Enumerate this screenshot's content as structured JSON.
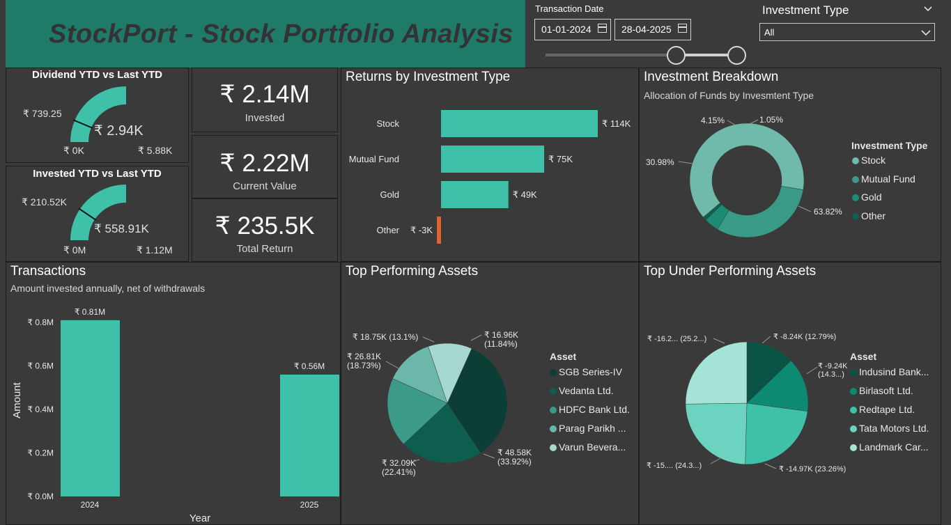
{
  "banner": {
    "title": "StockPort - Stock Portfolio Analysis"
  },
  "filters": {
    "transaction_date_label": "Transaction Date",
    "start_date": "01-01-2024",
    "end_date": "28-04-2025",
    "investment_type_label": "Investment Type",
    "investment_type_value": "All"
  },
  "gauges": [
    {
      "title": "Dividend YTD vs Last YTD",
      "target": "₹ 739.25",
      "value": "₹ 2.94K",
      "min": "₹ 0K",
      "max": "₹ 5.88K",
      "fill_fraction": 0.5,
      "target_fraction": 0.126
    },
    {
      "title": "Invested YTD vs Last YTD",
      "target": "₹ 210.52K",
      "value": "₹ 558.91K",
      "min": "₹ 0M",
      "max": "₹ 1.12M",
      "fill_fraction": 0.5,
      "target_fraction": 0.188
    }
  ],
  "kpis": [
    {
      "value": "₹ 2.14M",
      "label": "Invested"
    },
    {
      "value": "₹ 2.22M",
      "label": "Current Value"
    },
    {
      "value": "₹ 235.5K",
      "label": "Total Return"
    }
  ],
  "colors": {
    "teal": "#3ec1a8",
    "negative": "#e0622f",
    "donut": [
      "#6fbaab",
      "#3a9a88",
      "#1b8c73",
      "#11604f"
    ],
    "top_pie": [
      "#0b3f35",
      "#0e5e50",
      "#3b9a88",
      "#6bb8aa",
      "#a6d8cf"
    ],
    "under_pie": [
      "#0a5446",
      "#0d8a72",
      "#3ec1a8",
      "#6bd3bf",
      "#a5e3d7"
    ]
  },
  "returns": {
    "title": "Returns by Investment Type",
    "chart_data": {
      "type": "bar",
      "orientation": "horizontal",
      "categories": [
        "Stock",
        "Mutual Fund",
        "Gold",
        "Other"
      ],
      "values": [
        114,
        75,
        49,
        -3
      ],
      "labels": [
        "₹ 114K",
        "₹ 75K",
        "₹ 49K",
        "₹ -3K"
      ]
    }
  },
  "breakdown": {
    "title": "Investment Breakdown",
    "subtitle": "Allocation of Funds by Invesmtent Type",
    "legend_title": "Investment Type",
    "chart_data": {
      "type": "pie",
      "donut": true,
      "categories": [
        "Stock",
        "Mutual Fund",
        "Gold",
        "Other"
      ],
      "values": [
        63.82,
        30.98,
        4.15,
        1.05
      ],
      "labels": [
        "63.82%",
        "30.98%",
        "4.15%",
        "1.05%"
      ]
    }
  },
  "transactions": {
    "title": "Transactions",
    "subtitle": "Amount invested annually, net of withdrawals",
    "chart_data": {
      "type": "bar",
      "categories": [
        "2024",
        "2025"
      ],
      "values": [
        0.81,
        0.56
      ],
      "labels": [
        "₹ 0.81M",
        "₹ 0.56M"
      ],
      "xlabel": "Year",
      "ylabel": "Amount",
      "ylim": [
        0,
        0.8
      ],
      "yticks": [
        "₹ 0.0M",
        "₹ 0.2M",
        "₹ 0.4M",
        "₹ 0.6M",
        "₹ 0.8M"
      ],
      "grid": false
    }
  },
  "top_assets": {
    "title": "Top Performing Assets",
    "legend_title": "Asset",
    "chart_data": {
      "type": "pie",
      "categories": [
        "SGB Series-IV",
        "Vedanta Ltd.",
        "HDFC Bank Ltd.",
        "Parag Parikh ...",
        "Varun Bevera..."
      ],
      "values": [
        33.92,
        22.41,
        18.73,
        13.1,
        11.84
      ],
      "labels": [
        "₹ 48.58K\n(33.92%)",
        "₹ 32.09K\n(22.41%)",
        "₹ 26.81K\n(18.73%)",
        "₹ 18.75K (13.1%)",
        "₹ 16.96K\n(11.84%)"
      ]
    }
  },
  "under_assets": {
    "title": "Top Under Performing Assets",
    "legend_title": "Asset",
    "chart_data": {
      "type": "pie",
      "categories": [
        "Indusind Bank...",
        "Birlasoft Ltd.",
        "Redtape Ltd.",
        "Tata Motors Ltd.",
        "Landmark Car..."
      ],
      "values": [
        12.79,
        14.3,
        23.26,
        24.3,
        25.2
      ],
      "labels": [
        "₹ -8.24K (12.79%)",
        "₹ -9.24K\n(14.3...)",
        "₹ -14.97K (23.26%)",
        "₹ -15.... (24.3...)",
        "₹ -16.2... (25.2...)"
      ]
    }
  }
}
